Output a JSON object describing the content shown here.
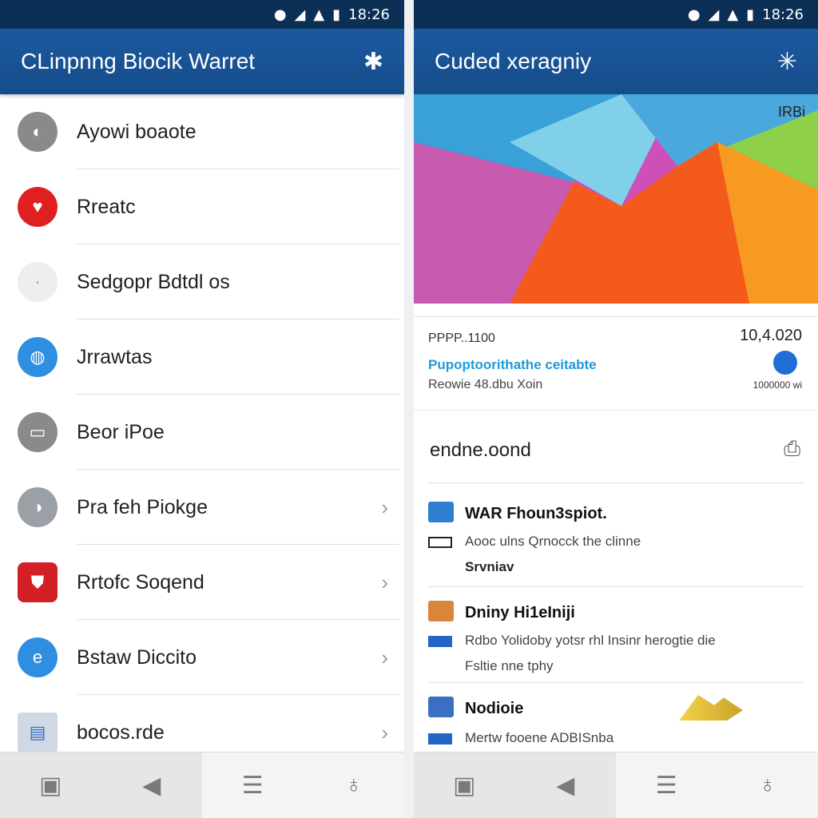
{
  "left": {
    "status_time": "18:26",
    "title": "CLinpnng Biocik Warret",
    "action_icon": "gear-icon",
    "items": [
      {
        "label": "Ayowi boaote",
        "icon": "gray-circle-icon",
        "color": "#8a8a8a",
        "chevron": false
      },
      {
        "label": "Rreatc",
        "icon": "red-heart-icon",
        "color": "#e02020",
        "chevron": false
      },
      {
        "label": "Sedgopr Bdtdl os",
        "icon": "blank-circle-icon",
        "color": "#eeeeee",
        "chevron": false
      },
      {
        "label": "Jrrawtas",
        "icon": "blue-globe-icon",
        "color": "#2e8ee0",
        "chevron": false
      },
      {
        "label": "Beor iPoe",
        "icon": "gray-card-icon",
        "color": "#8a8a8a",
        "chevron": false
      },
      {
        "label": "Pra feh Piokge",
        "icon": "gray-green-icon",
        "color": "#9aa0a6",
        "chevron": true
      },
      {
        "label": "Rrtofc Soqend",
        "icon": "red-shield-icon",
        "color": "#d32027",
        "chevron": true
      },
      {
        "label": "Bstaw Diccito",
        "icon": "blue-e-icon",
        "color": "#2e8ee0",
        "chevron": true
      },
      {
        "label": "bocos.rde",
        "icon": "document-icon",
        "color": "#cfd8e3",
        "chevron": true
      }
    ],
    "nav": [
      "wallet-icon",
      "back-icon",
      "menu-icon",
      "lightbulb-icon"
    ]
  },
  "right": {
    "status_time": "18:26",
    "title": "Cuded xeragniy",
    "action_icon": "asterisk-icon",
    "hero_label": "IRBi",
    "card": {
      "line1": "PPPP..1100",
      "line2": "Pupoptoorithathe ceitabte",
      "line3": "Reowie 48.dbu Xoin",
      "amount": "10,4.020",
      "small": "1000000 wi"
    },
    "section_title": "endne.oond",
    "section_icon": "printer-icon",
    "entries": [
      {
        "title": "WAR  Fhoun3spiot.",
        "sub1": "Aooc ulns Qrnocck the clinne",
        "sub2": "Srvniav",
        "icon_color": "#2f7fd0"
      },
      {
        "title": "Dniny  Hi1eIniji",
        "sub1": "Rdbo Yolidoby yotsr rhl Insinr herogtie die",
        "sub2": "Fsltie nne tphy",
        "icon_color": "#d9863b"
      },
      {
        "title": "Nodioie",
        "sub1": "Mertw fooene ADBISnba",
        "sub2": "",
        "icon_color": "#3a6fc4"
      }
    ],
    "nav": [
      "wallet-icon",
      "back-icon",
      "menu-icon",
      "lightbulb-icon"
    ]
  }
}
